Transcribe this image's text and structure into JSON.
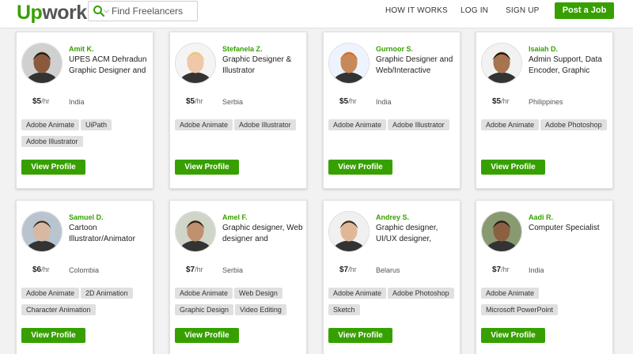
{
  "header": {
    "logo_up": "Up",
    "logo_work": "work",
    "search_placeholder": "Find Freelancers",
    "nav": [
      "HOW IT WORKS",
      "LOG IN",
      "SIGN UP"
    ],
    "post_job": "Post a Job"
  },
  "colors": {
    "brand": "#37a000"
  },
  "view_profile_label": "View Profile",
  "freelancers": [
    {
      "name": "Amit K.",
      "title": "UPES ACM Dehradun Graphic Designer and",
      "rate": "$5",
      "unit": "/hr",
      "country": "India",
      "skills": [
        "Adobe Animate",
        "UiPath",
        "Adobe Illustrator"
      ]
    },
    {
      "name": "Stefanela Z.",
      "title": "Graphic Designer & Illustrator",
      "rate": "$5",
      "unit": "/hr",
      "country": "Serbia",
      "skills": [
        "Adobe Animate",
        "Adobe Illustrator"
      ]
    },
    {
      "name": "Gurnoor S.",
      "title": "Graphic Designer and Web/Interactive",
      "rate": "$5",
      "unit": "/hr",
      "country": "India",
      "skills": [
        "Adobe Animate",
        "Adobe Illustrator"
      ]
    },
    {
      "name": "Isaiah D.",
      "title": "Admin Support, Data Encoder, Graphic",
      "rate": "$5",
      "unit": "/hr",
      "country": "Philippines",
      "skills": [
        "Adobe Animate",
        "Adobe Photoshop"
      ]
    },
    {
      "name": "Samuel D.",
      "title": "Cartoon Illustrator/Animator",
      "rate": "$6",
      "unit": "/hr",
      "country": "Colombia",
      "skills": [
        "Adobe Animate",
        "2D Animation",
        "Character Animation"
      ]
    },
    {
      "name": "Amel F.",
      "title": "Graphic designer, Web designer and",
      "rate": "$7",
      "unit": "/hr",
      "country": "Serbia",
      "skills": [
        "Adobe Animate",
        "Web Design",
        "Graphic Design",
        "Video Editing"
      ]
    },
    {
      "name": "Andrey S.",
      "title": "Graphic designer, UI/UX designer,",
      "rate": "$7",
      "unit": "/hr",
      "country": "Belarus",
      "skills": [
        "Adobe Animate",
        "Adobe Photoshop",
        "Sketch"
      ]
    },
    {
      "name": "Aadi R.",
      "title": "Computer Specialist",
      "rate": "$7",
      "unit": "/hr",
      "country": "India",
      "skills": [
        "Adobe Animate",
        "Microsoft PowerPoint"
      ]
    }
  ]
}
